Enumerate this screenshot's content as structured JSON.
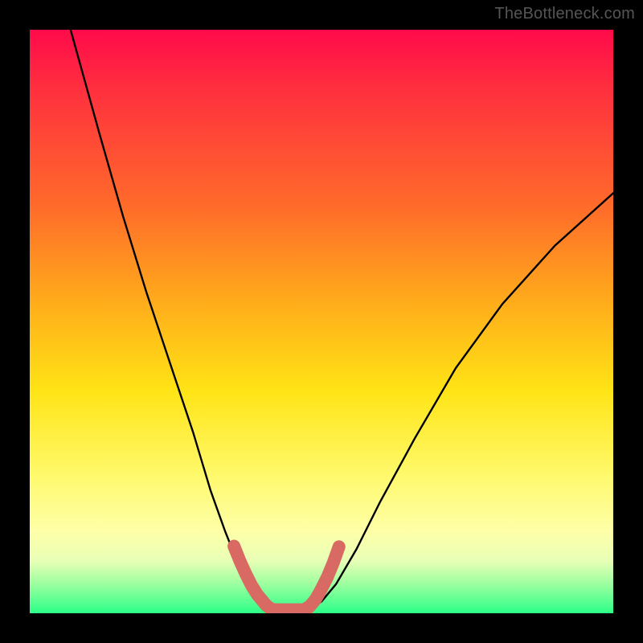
{
  "watermark": "TheBottleneck.com",
  "chart_data": {
    "type": "line",
    "title": "",
    "xlabel": "",
    "ylabel": "",
    "xlim": [
      0,
      100
    ],
    "ylim": [
      0,
      100
    ],
    "series": [
      {
        "name": "left-curve",
        "x": [
          7,
          12,
          16,
          20,
          24,
          28,
          31,
          33.5,
          35.5,
          37,
          38.5,
          40,
          41.5
        ],
        "y": [
          100,
          82,
          68,
          55,
          43,
          31,
          21,
          14,
          9,
          5.5,
          3,
          1.5,
          0.6
        ]
      },
      {
        "name": "right-curve",
        "x": [
          48,
          50,
          52.5,
          56,
          60,
          66,
          73,
          81,
          90,
          100
        ],
        "y": [
          0.6,
          2,
          5,
          11,
          19,
          30,
          42,
          53,
          63,
          72
        ]
      },
      {
        "name": "pink-trough-left",
        "x": [
          35,
          36,
          37,
          38,
          39,
          40,
          40.5,
          41,
          41.5,
          42
        ],
        "y": [
          11.5,
          9,
          6.8,
          4.8,
          3.2,
          2,
          1.4,
          1,
          0.7,
          0.6
        ]
      },
      {
        "name": "pink-trough-bottom",
        "x": [
          41.5,
          43,
          44.5,
          46,
          47.5
        ],
        "y": [
          0.6,
          0.6,
          0.6,
          0.6,
          0.6
        ]
      },
      {
        "name": "pink-trough-right",
        "x": [
          47,
          48,
          49,
          50,
          51,
          52,
          53
        ],
        "y": [
          0.6,
          1.2,
          2.4,
          4.2,
          6.2,
          8.6,
          11.4
        ]
      }
    ],
    "annotations": [],
    "legend": false,
    "grid": false,
    "background_gradient": [
      "#ff0a4a",
      "#ffb11a",
      "#fff96a",
      "#2bff88"
    ]
  }
}
